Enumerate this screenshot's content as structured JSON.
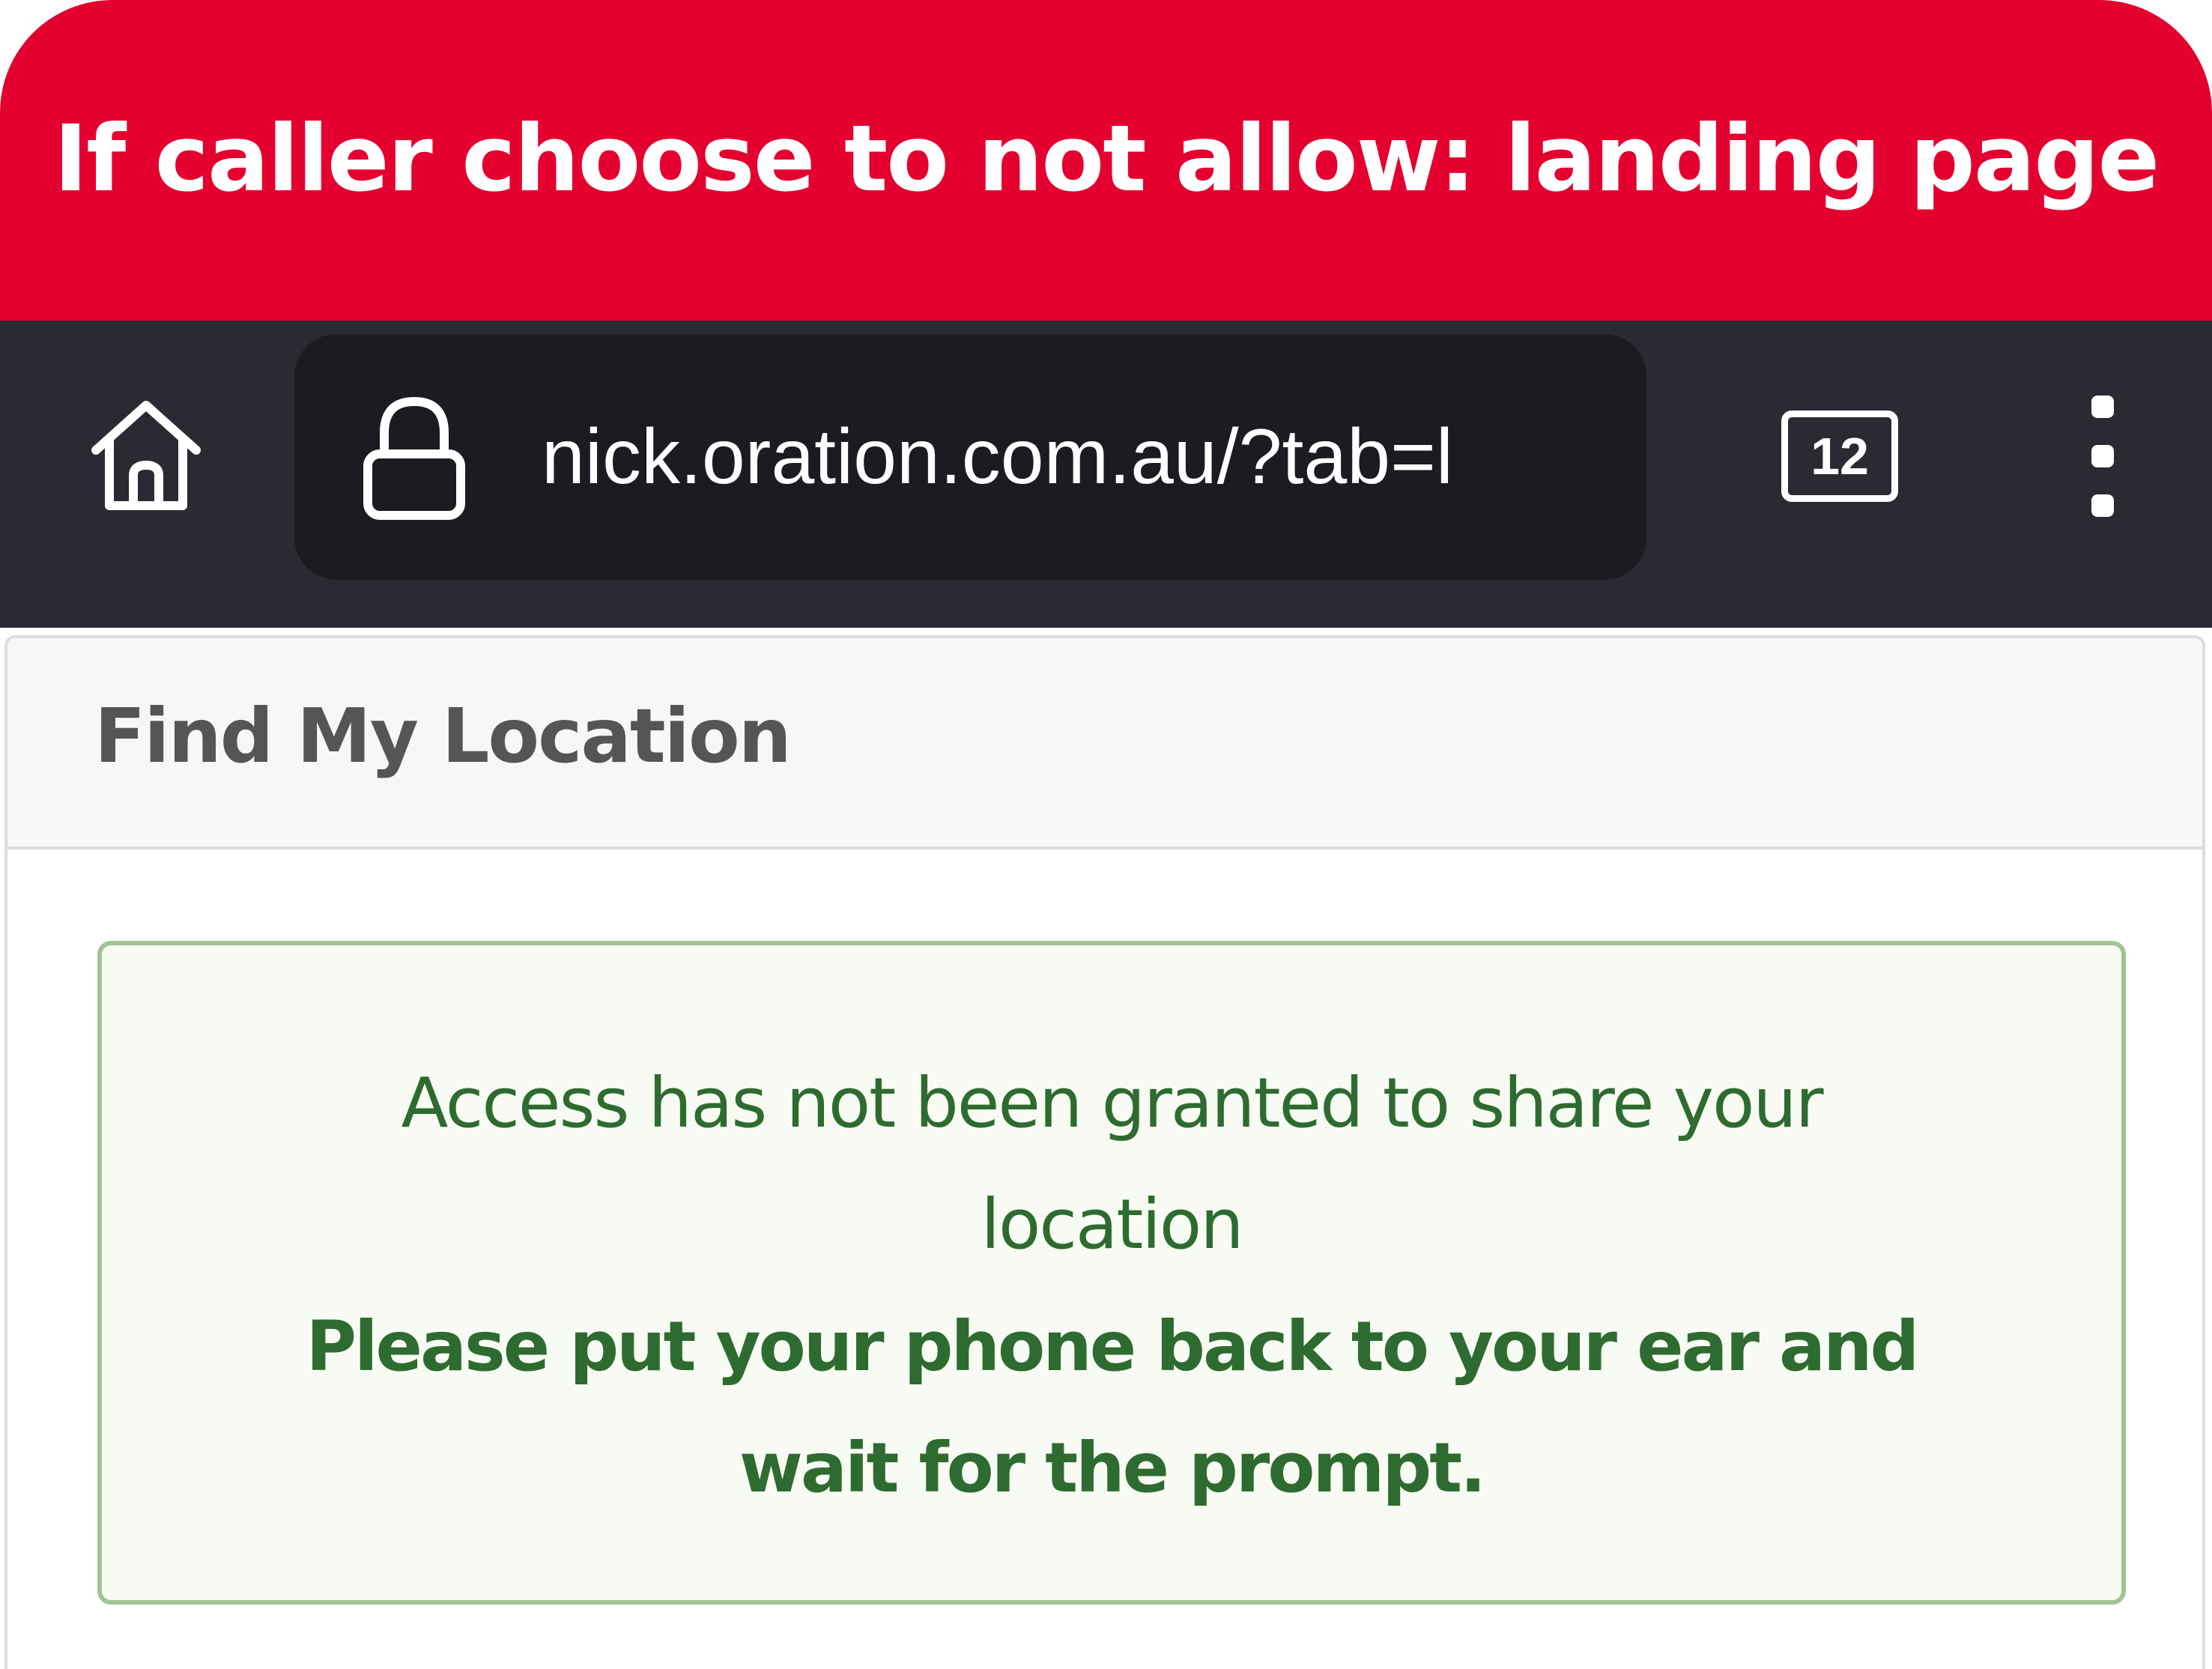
{
  "banner": {
    "title": "If caller choose to not allow: landing page",
    "color": "#e4002f"
  },
  "browser": {
    "home_icon": "home-icon",
    "lock_icon": "lock-icon",
    "url": "nick.oration.com.au/?tab=l",
    "tab_count": "12",
    "menu_icon": "vertical-dots-menu-icon"
  },
  "page": {
    "title": "Find My Location",
    "alert": {
      "message_lines": [
        "Access has not been granted to share your",
        "location"
      ],
      "instruction_lines": [
        "Please put your phone back to your ear and",
        "wait for the prompt."
      ],
      "text_color": "#2e6b30",
      "background": "#f8fbf3",
      "border_color": "#9fc496"
    }
  }
}
